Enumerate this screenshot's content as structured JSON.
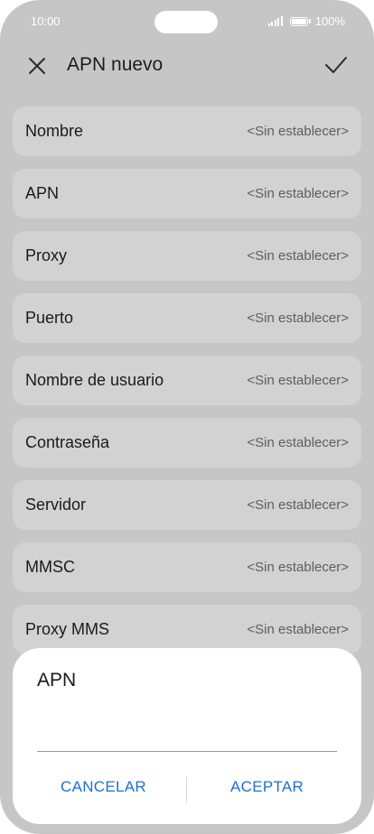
{
  "status": {
    "time": "10:00",
    "battery": "100%"
  },
  "header": {
    "title": "APN nuevo"
  },
  "rows": [
    {
      "label": "Nombre",
      "value": "<Sin establecer>"
    },
    {
      "label": "APN",
      "value": "<Sin establecer>"
    },
    {
      "label": "Proxy",
      "value": "<Sin establecer>"
    },
    {
      "label": "Puerto",
      "value": "<Sin establecer>"
    },
    {
      "label": "Nombre de usuario",
      "value": "<Sin establecer>"
    },
    {
      "label": "Contraseña",
      "value": "<Sin establecer>"
    },
    {
      "label": "Servidor",
      "value": "<Sin establecer>"
    },
    {
      "label": "MMSC",
      "value": "<Sin establecer>"
    },
    {
      "label": "Proxy MMS",
      "value": "<Sin establecer>"
    }
  ],
  "dialog": {
    "title": "APN",
    "input_value": "",
    "cancel_label": "CANCELAR",
    "accept_label": "ACEPTAR"
  },
  "colors": {
    "accent": "#1f6fd6",
    "background_dim": "#c6c6c6",
    "row_bg": "#d2d2d2"
  }
}
